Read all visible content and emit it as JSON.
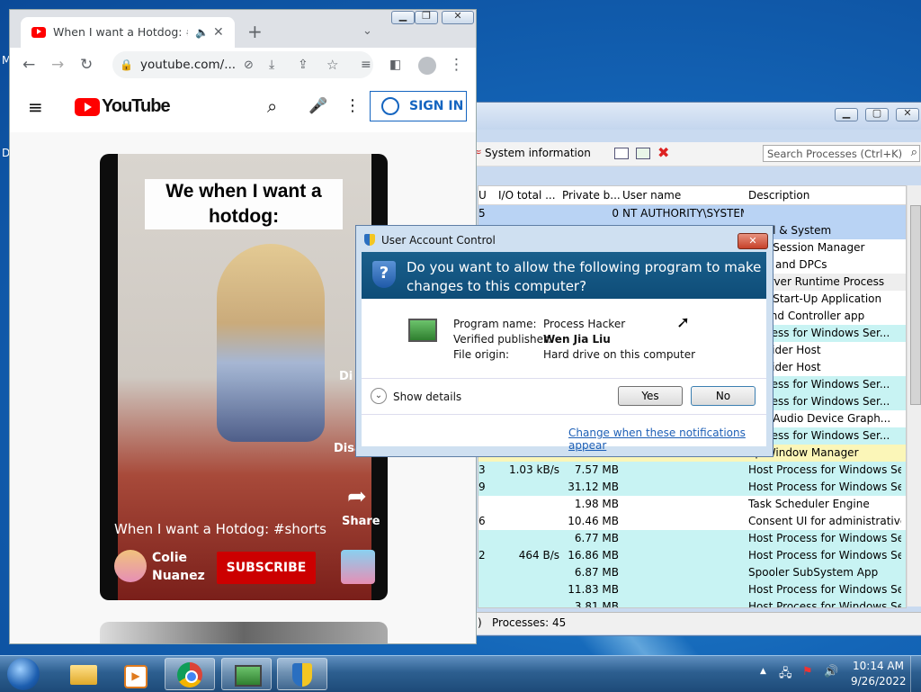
{
  "desktop": {
    "edge_letters": [
      "M",
      "D"
    ]
  },
  "process_hacker": {
    "toolbar": {
      "system_information": "System information"
    },
    "search_placeholder": "Search Processes (Ctrl+K)",
    "columns": [
      "U",
      "I/O total ...",
      "Private b...",
      "User name",
      "Description"
    ],
    "rows": [
      {
        "cpu": "5",
        "io": "",
        "priv": "0",
        "user": "NT AUTHORITY\\SYSTEM",
        "desc": "",
        "color": "#b9d3f4"
      },
      {
        "cpu": "",
        "io": "",
        "priv": "",
        "user": "",
        "desc": "ernel & System",
        "color": "#b9d3f4"
      },
      {
        "cpu": "",
        "io": "",
        "priv": "",
        "user": "",
        "desc": "ows Session Manager",
        "color": "#ffffff"
      },
      {
        "cpu": "",
        "io": "",
        "priv": "",
        "user": "",
        "desc": "upts and DPCs",
        "color": "#ffffff"
      },
      {
        "cpu": "",
        "io": "",
        "priv": "",
        "user": "",
        "desc": "t Server Runtime Process",
        "color": "#eeeeee"
      },
      {
        "cpu": "",
        "io": "",
        "priv": "",
        "user": "",
        "desc": "ows Start-Up Application",
        "color": "#ffffff"
      },
      {
        "cpu": "",
        "io": "",
        "priv": "",
        "user": "",
        "desc": "es and Controller app",
        "color": "#ffffff"
      },
      {
        "cpu": "",
        "io": "",
        "priv": "",
        "user": "",
        "desc": "Process for Windows Ser...",
        "color": "#c8f3f3"
      },
      {
        "cpu": "",
        "io": "",
        "priv": "",
        "user": "",
        "desc": "Provider Host",
        "color": "#ffffff"
      },
      {
        "cpu": "",
        "io": "",
        "priv": "",
        "user": "",
        "desc": "Provider Host",
        "color": "#ffffff"
      },
      {
        "cpu": "",
        "io": "",
        "priv": "",
        "user": "",
        "desc": "Process for Windows Ser...",
        "color": "#c8f3f3"
      },
      {
        "cpu": "",
        "io": "",
        "priv": "",
        "user": "",
        "desc": "Process for Windows Ser...",
        "color": "#c8f3f3"
      },
      {
        "cpu": "",
        "io": "",
        "priv": "",
        "user": "",
        "desc": "ows Audio Device Graph...",
        "color": "#ffffff"
      },
      {
        "cpu": "",
        "io": "",
        "priv": "",
        "user": "",
        "desc": "Process for Windows Ser...",
        "color": "#c8f3f3"
      },
      {
        "cpu": "",
        "io": "",
        "priv": "",
        "user": "",
        "desc": "op Window Manager",
        "color": "#fbf6b8"
      },
      {
        "cpu": "3",
        "io": "1.03 kB/s",
        "priv": "7.57 MB",
        "user": "",
        "desc": "Host Process for Windows Ser...",
        "color": "#c8f3f3"
      },
      {
        "cpu": "9",
        "io": "",
        "priv": "31.12 MB",
        "user": "",
        "desc": "Host Process for Windows Ser...",
        "color": "#c8f3f3"
      },
      {
        "cpu": "",
        "io": "",
        "priv": "1.98 MB",
        "user": "",
        "desc": "Task Scheduler Engine",
        "color": "#ffffff"
      },
      {
        "cpu": "6",
        "io": "",
        "priv": "10.46 MB",
        "user": "",
        "desc": "Consent UI for administrative ...",
        "color": "#ffffff"
      },
      {
        "cpu": "",
        "io": "",
        "priv": "6.77 MB",
        "user": "",
        "desc": "Host Process for Windows Ser...",
        "color": "#c8f3f3"
      },
      {
        "cpu": "2",
        "io": "464 B/s",
        "priv": "16.86 MB",
        "user": "",
        "desc": "Host Process for Windows Ser...",
        "color": "#c8f3f3"
      },
      {
        "cpu": "",
        "io": "",
        "priv": "6.87 MB",
        "user": "",
        "desc": "Spooler SubSystem App",
        "color": "#c8f3f3"
      },
      {
        "cpu": "",
        "io": "",
        "priv": "11.83 MB",
        "user": "",
        "desc": "Host Process for Windows Ser...",
        "color": "#c8f3f3"
      },
      {
        "cpu": "",
        "io": "",
        "priv": "3.81 MB",
        "user": "",
        "desc": "Host Process for Windows Ser...",
        "color": "#c8f3f3"
      }
    ],
    "status": {
      "left": ")",
      "processes": "Processes: 45"
    }
  },
  "chrome": {
    "tab_title": "When I want a Hotdog: #sho",
    "address": "youtube.com/...",
    "youtube": {
      "logo_text": "YouTube",
      "sign_in": "SIGN IN"
    },
    "video": {
      "caption": "We when I want a hotdog:",
      "title": "When I want a Hotdog: #shorts",
      "channel_line1": "Colie",
      "channel_line2": "Nuanez",
      "subscribe": "SUBSCRIBE",
      "side_labels": [
        "Di",
        "Disa",
        "Share"
      ]
    }
  },
  "uac": {
    "title": "User Account Control",
    "question": "Do you want to allow the following program to make changes to this computer?",
    "fields": [
      {
        "label": "Program name:",
        "value": "Process Hacker"
      },
      {
        "label": "Verified publisher:",
        "value": "Wen Jia Liu"
      },
      {
        "label": "File origin:",
        "value": "Hard drive on this computer"
      }
    ],
    "show_details": "Show details",
    "yes": "Yes",
    "no": "No",
    "change_link": "Change when these notifications appear"
  },
  "taskbar": {
    "time": "10:14 AM",
    "date": "9/26/2022",
    "items": [
      "start",
      "explorer",
      "media-player",
      "chrome",
      "process-hacker",
      "uac-shield"
    ]
  },
  "colors": {
    "uac_banner": "#145a86",
    "youtube_red": "#ff0000",
    "link_blue": "#1d5fb6"
  }
}
